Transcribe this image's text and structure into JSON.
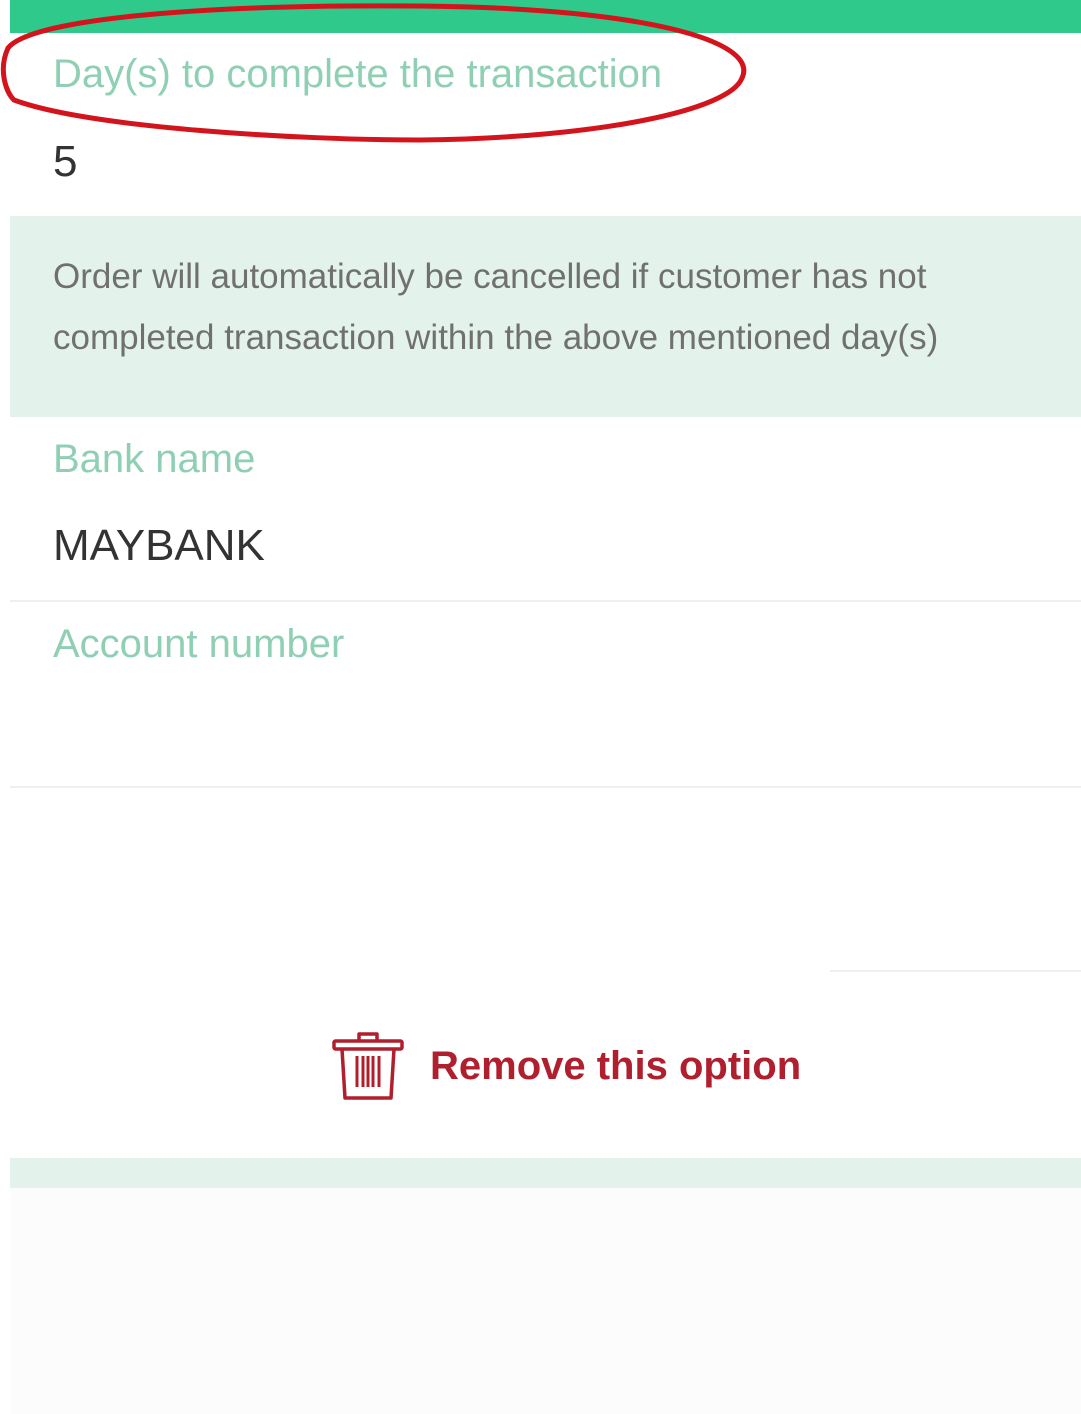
{
  "transaction_days": {
    "label": "Day(s) to complete the transaction",
    "value": "5"
  },
  "notice": {
    "text": "Order will automatically be cancelled if customer has not completed transaction within the above mentioned day(s)"
  },
  "bank_name": {
    "label": "Bank name",
    "value": "MAYBANK"
  },
  "account_number": {
    "label": "Account number",
    "value": ""
  },
  "remove_option": {
    "label": "Remove this option",
    "icon": "trash-icon"
  },
  "colors": {
    "accent": "#2ec98b",
    "label": "#8fcfb3",
    "notice_background": "#e3f3ec",
    "danger": "#b01f2e",
    "annotation": "#d4141c"
  }
}
